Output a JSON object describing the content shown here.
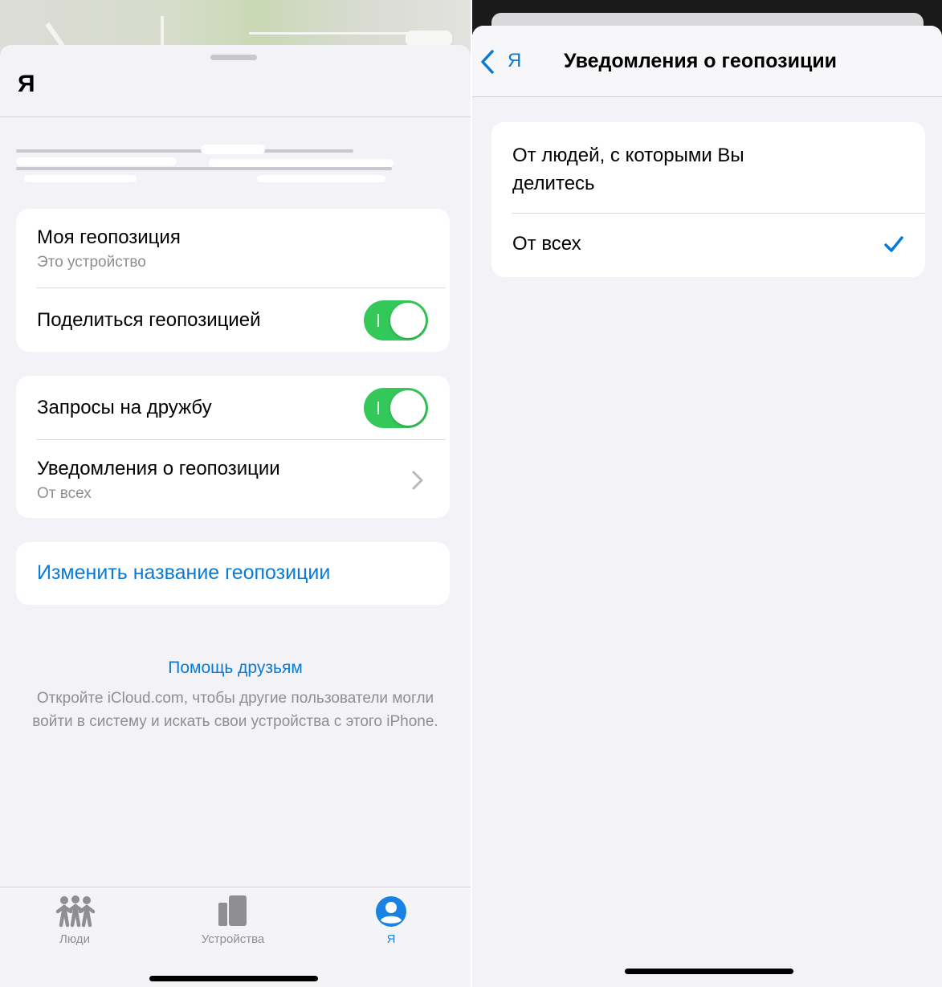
{
  "left": {
    "title": "Я",
    "my_location": {
      "label": "Моя геопозиция",
      "subtitle": "Это устройство"
    },
    "share_location": {
      "label": "Поделиться геопозицией",
      "on": true
    },
    "friend_requests": {
      "label": "Запросы на дружбу",
      "on": true
    },
    "location_alerts": {
      "label": "Уведомления о геопозиции",
      "value": "От всех"
    },
    "rename_location": "Изменить название геопозиции",
    "help": {
      "title": "Помощь друзьям",
      "text": "Откройте iCloud.com, чтобы другие пользователи могли войти в систему и искать свои устройства с этого iPhone."
    },
    "tabs": [
      {
        "label": "Люди",
        "icon": "people-icon",
        "selected": false
      },
      {
        "label": "Устройства",
        "icon": "devices-icon",
        "selected": false
      },
      {
        "label": "Я",
        "icon": "me-icon",
        "selected": true
      }
    ]
  },
  "right": {
    "back_label": "Я",
    "title": "Уведомления о геопозиции",
    "options": [
      {
        "label": "От людей, с которыми Вы делитесь",
        "checked": false
      },
      {
        "label": "От всех",
        "checked": true
      }
    ]
  },
  "colors": {
    "accent": "#0a7ad6",
    "toggle_on": "#34c759",
    "background": "#f2f2f7",
    "secondary_text": "#8e8e93"
  }
}
